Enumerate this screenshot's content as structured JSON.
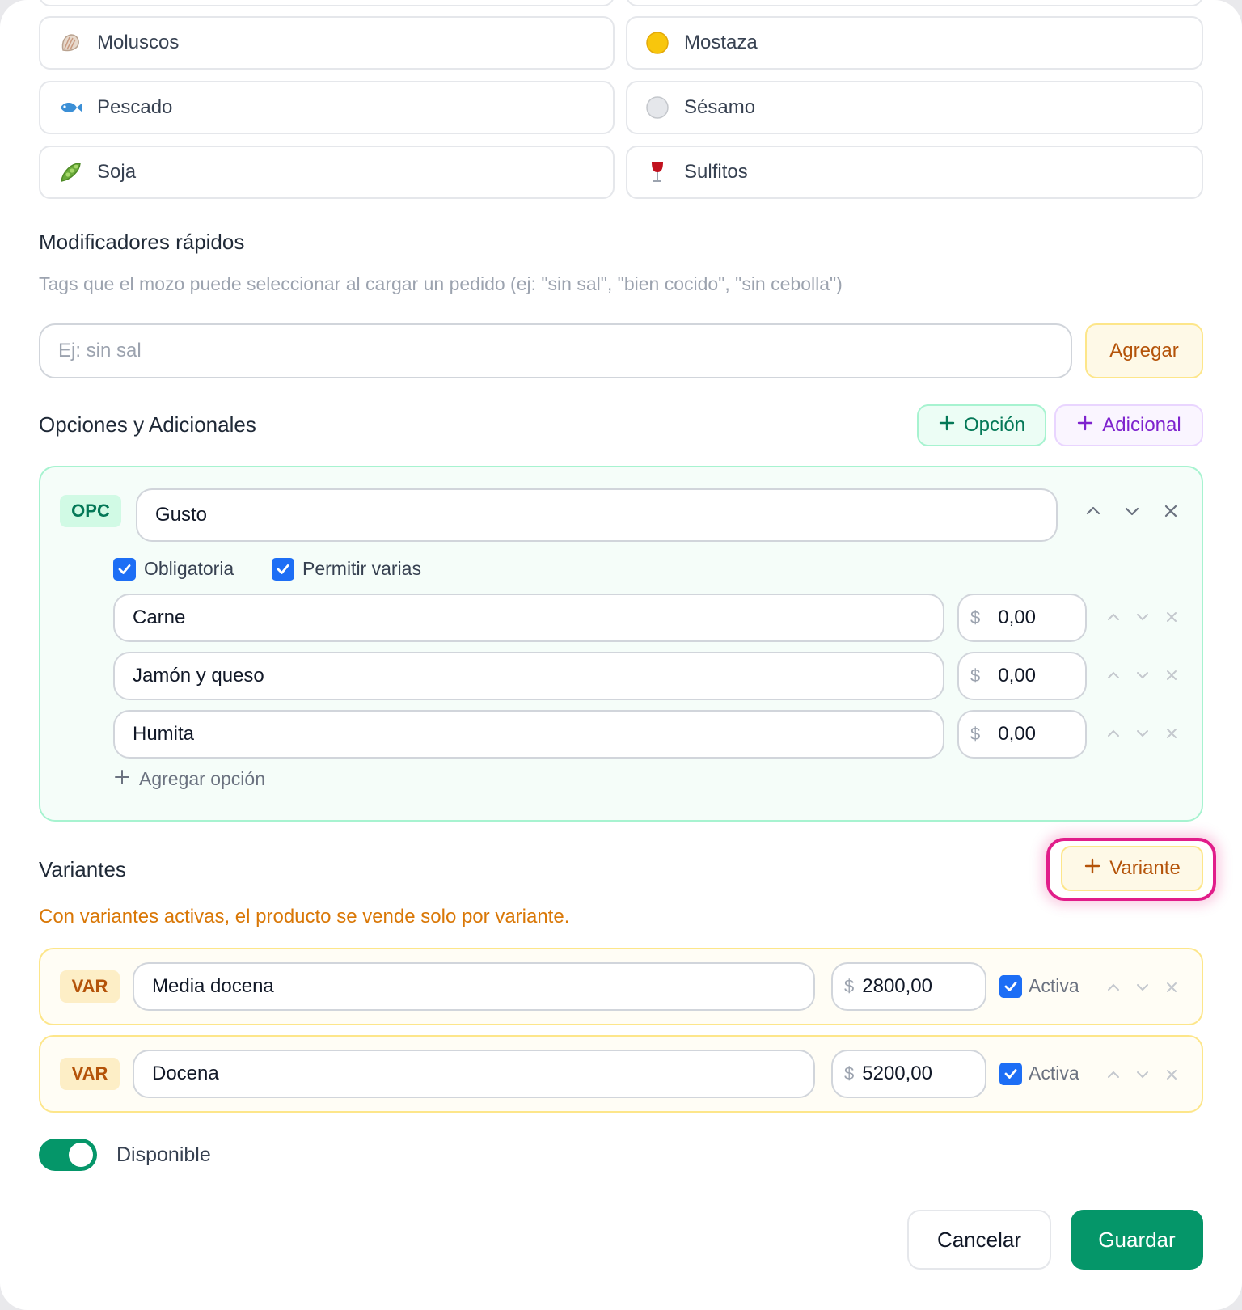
{
  "allergens": [
    {
      "label": "Moluscos",
      "icon": "shell-icon"
    },
    {
      "label": "Mostaza",
      "icon": "mustard-dot-icon"
    },
    {
      "label": "Pescado",
      "icon": "fish-icon"
    },
    {
      "label": "Sésamo",
      "icon": "sesame-dot-icon"
    },
    {
      "label": "Soja",
      "icon": "pea-pod-icon"
    },
    {
      "label": "Sulfitos",
      "icon": "wine-glass-icon"
    }
  ],
  "quick_modifiers": {
    "title": "Modificadores rápidos",
    "hint": "Tags que el mozo puede seleccionar al cargar un pedido (ej: \"sin sal\", \"bien cocido\", \"sin cebolla\")",
    "placeholder": "Ej: sin sal",
    "add_label": "Agregar"
  },
  "options_section": {
    "title": "Opciones y Adicionales",
    "add_option_label": "Opción",
    "add_extra_label": "Adicional",
    "group": {
      "tag": "OPC",
      "name": "Gusto",
      "required_label": "Obligatoria",
      "multiple_label": "Permitir varias",
      "required": true,
      "multiple": true,
      "items": [
        {
          "name": "Carne",
          "currency": "$",
          "price": "0,00"
        },
        {
          "name": "Jamón y queso",
          "currency": "$",
          "price": "0,00"
        },
        {
          "name": "Humita",
          "currency": "$",
          "price": "0,00"
        }
      ],
      "add_item_label": "Agregar opción"
    }
  },
  "variants_section": {
    "title": "Variantes",
    "add_label": "Variante",
    "warning": "Con variantes activas, el producto se vende solo por variante.",
    "items": [
      {
        "tag": "VAR",
        "name": "Media docena",
        "currency": "$",
        "price": "2800,00",
        "active_label": "Activa",
        "active": true
      },
      {
        "tag": "VAR",
        "name": "Docena",
        "currency": "$",
        "price": "5200,00",
        "active_label": "Activa",
        "active": true
      }
    ]
  },
  "availability": {
    "label": "Disponible",
    "on": true
  },
  "footer": {
    "cancel_label": "Cancelar",
    "save_label": "Guardar"
  },
  "colors": {
    "primary_green": "#059669",
    "accent_amber": "#b45309",
    "highlight_pink": "#e11d8a",
    "checkbox_blue": "#1d6ef5"
  }
}
